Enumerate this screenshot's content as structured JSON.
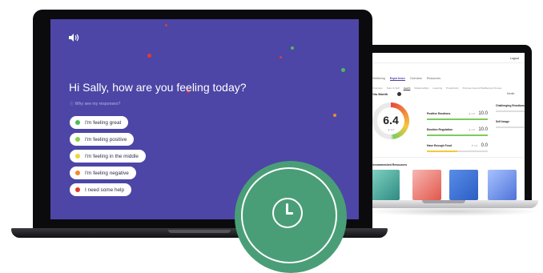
{
  "chat": {
    "greeting": "Hi Sally, how are you feeling today?",
    "why_link": "ⓘ Why see my responses?",
    "options": [
      {
        "label": "I'm feeling great",
        "color": "#4cbb5a"
      },
      {
        "label": "I'm feeling positive",
        "color": "#8bd04a"
      },
      {
        "label": "I'm feeling in the middle",
        "color": "#f1d33a"
      },
      {
        "label": "I'm feeling negative",
        "color": "#f08a30"
      },
      {
        "label": "I need some help",
        "color": "#e23b2e"
      }
    ],
    "icons": {
      "sound": "speaker-icon"
    },
    "background_color": "#4d46a6"
  },
  "dashboard": {
    "logout": "Logout",
    "tabs": [
      "Wellbeing",
      "Experience",
      "Overview",
      "Resources"
    ],
    "active_tab": "Experience",
    "subtabs": [
      "Overview",
      "Team & Self",
      "Health",
      "Relationships",
      "Learning",
      "Productivity",
      "Purpose beyond Wellbeing & Survey"
    ],
    "active_subtab": "Health",
    "period": "This Month",
    "period_right": "Month",
    "score": "6.4",
    "score_sub": "▲ 0.3",
    "metrics": [
      {
        "label": "Positive Emotions",
        "prev": "▲ 0.8",
        "score": "10.0",
        "color": "#7ccb5e",
        "level": 1.0
      },
      {
        "label": "Emotion Regulation",
        "prev": "▲ 0.8",
        "score": "10.0",
        "color": "#7ccb5e",
        "level": 1.0
      },
      {
        "label": "Have Enough Food",
        "prev": "▼ 0.6",
        "score": "0.0",
        "color": "#f5c83d",
        "level": 0.5
      }
    ],
    "metrics_right": [
      {
        "label": "Challenging Emotions"
      },
      {
        "label": "Self Image"
      }
    ],
    "resources_title": "Recommended Resources"
  },
  "badge": {
    "icon": "clock-icon",
    "color": "#4a9e77"
  }
}
